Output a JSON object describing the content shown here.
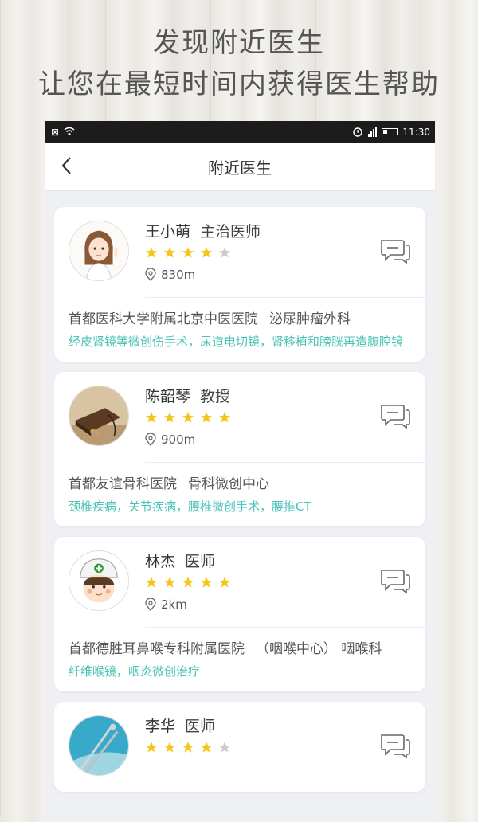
{
  "promo": {
    "line1": "发现附近医生",
    "line2": "让您在最短时间内获得医生帮助"
  },
  "statusbar": {
    "time": "11:30",
    "icons": [
      "no-sim-icon",
      "wifi-icon",
      "alarm-icon",
      "signal-icon",
      "battery-icon"
    ]
  },
  "nav": {
    "title": "附近医生",
    "back_icon": "chevron-left-icon"
  },
  "colors": {
    "star_on": "#f5c518",
    "star_off": "#cccccc",
    "specialty": "#4cc3b8",
    "statusbar_bg": "#1c1c1c"
  },
  "doctors": [
    {
      "name": "王小萌",
      "title": "主治医师",
      "rating": 4,
      "distance": "830m",
      "hospital": "首都医科大学附属北京中医医院",
      "department": "泌尿肿瘤外科",
      "specialties": "经皮肾镜等微创伤手术，尿道电切镜，肾移植和膀胱再造腹腔镜"
    },
    {
      "name": "陈韶琴",
      "title": "教授",
      "rating": 5,
      "distance": "900m",
      "hospital": "首都友谊骨科医院",
      "department": "骨科微创中心",
      "specialties": "颈椎疾病，关节疾病，腰椎微创手术，腰推CT"
    },
    {
      "name": "林杰",
      "title": "医师",
      "rating": 5,
      "distance": "2km",
      "hospital": "首都德胜耳鼻喉专科附属医院",
      "department": "（咽喉中心） 咽喉科",
      "specialties": "纤维喉镜，咽炎微创治疗"
    },
    {
      "name": "李华",
      "title": "医师",
      "rating": 4
    }
  ]
}
